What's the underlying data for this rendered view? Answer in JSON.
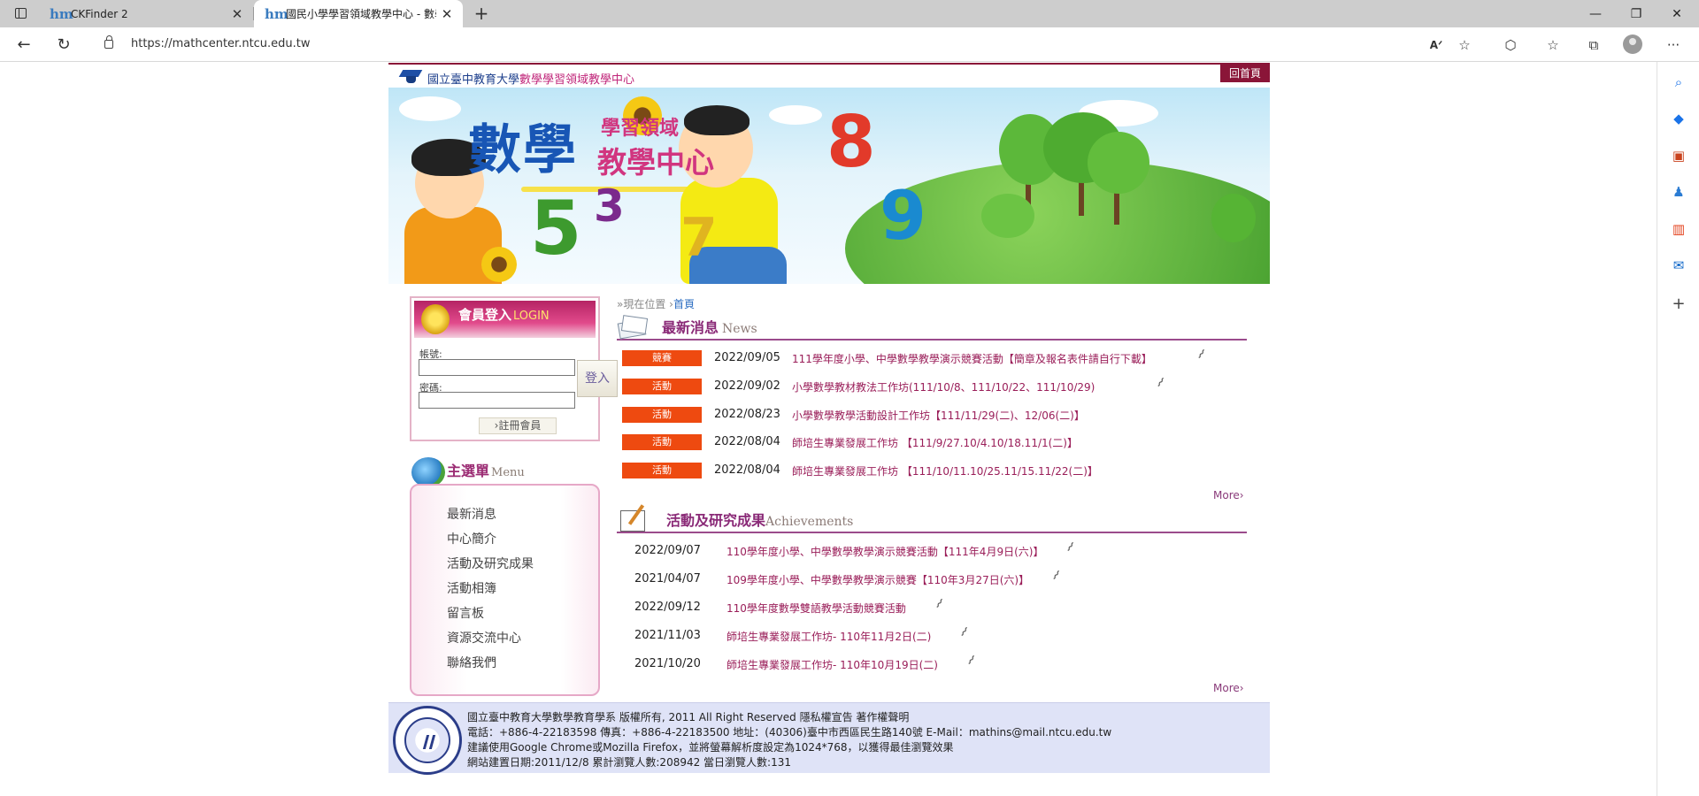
{
  "browser": {
    "tabs": [
      {
        "title": "CKFinder 2",
        "favicon": "hm"
      },
      {
        "title": "國民小學學習領域教學中心 - 數學",
        "favicon": "hm"
      }
    ],
    "url": "https://mathcenter.ntcu.edu.tw",
    "new_tab": "+",
    "icons": [
      "sidebar-toggle-icon",
      "back-icon",
      "refresh-icon",
      "lock-icon",
      "read-aloud-icon",
      "favorite-add-icon",
      "extensions-icon",
      "favorites-icon",
      "collections-icon",
      "profile-icon",
      "more-icon"
    ],
    "side_icons": [
      "search-icon",
      "shopping-icon",
      "tools-icon",
      "games-icon",
      "office-icon",
      "outlook-icon",
      "add-icon"
    ]
  },
  "site": {
    "title_main": "國立臺中教育大學",
    "title_sub": "數學學習領域教學中心",
    "home_link": "回首頁",
    "banner": {
      "title": "數學",
      "sub1": "學習領域",
      "sub2": "教學中心",
      "numbers": [
        "5",
        "3",
        "7",
        "8",
        "9"
      ]
    },
    "login": {
      "title": "會員登入",
      "title_en": "LOGIN",
      "account_label": "帳號:",
      "password_label": "密碼:",
      "submit": "登入",
      "register": "›註冊會員"
    },
    "menu": {
      "title": "主選單",
      "title_en": "Menu",
      "items": [
        "最新消息",
        "中心簡介",
        "活動及研究成果",
        "活動相簿",
        "留言板",
        "資源交流中心",
        "聯絡我們"
      ]
    },
    "breadcrumb": {
      "prefix": "»現在位置 ›",
      "current": "首頁"
    },
    "news": {
      "title": "最新消息",
      "title_en": "News",
      "more": "More›",
      "items": [
        {
          "badge": "競賽",
          "date": "2022/09/05",
          "title": "111學年度小學、中學數學教學演示競賽活動【簡章及報名表件請自行下載】"
        },
        {
          "badge": "活動",
          "date": "2022/09/02",
          "title": "小學數學教材教法工作坊(111/10/8、111/10/22、111/10/29)"
        },
        {
          "badge": "活動",
          "date": "2022/08/23",
          "title": "小學數學教學活動設計工作坊【111/11/29(二)、12/06(二)】"
        },
        {
          "badge": "活動",
          "date": "2022/08/04",
          "title": "師培生專業發展工作坊 【111/9/27.10/4.10/18.11/1(二)】"
        },
        {
          "badge": "活動",
          "date": "2022/08/04",
          "title": "師培生專業發展工作坊 【111/10/11.10/25.11/15.11/22(二)】"
        }
      ]
    },
    "achievements": {
      "title": "活動及研究成果",
      "title_en": "Achievements",
      "more": "More›",
      "items": [
        {
          "date": "2022/09/07",
          "title": "110學年度小學、中學數學教學演示競賽活動【111年4月9日(六)】"
        },
        {
          "date": "2021/04/07",
          "title": "109學年度小學、中學數學教學演示競賽【110年3月27日(六)】"
        },
        {
          "date": "2022/09/12",
          "title": "110學年度數學雙語教學活動競賽活動"
        },
        {
          "date": "2021/11/03",
          "title": "師培生專業發展工作坊- 110年11月2日(二)"
        },
        {
          "date": "2021/10/20",
          "title": "師培生專業發展工作坊- 110年10月19日(二)"
        }
      ]
    },
    "footer": {
      "line1": "國立臺中教育大學數學教育學系 版權所有, 2011 All Right Reserved 隱私權宣告 著作權聲明",
      "line2": "電話：+886-4-22183598 傳真：+886-4-22183500 地址：(40306)臺中市西區民生路140號 E-Mail：mathins@mail.ntcu.edu.tw",
      "line3": "建議使用Google Chrome或Mozilla Firefox，並將螢幕解析度設定為1024*768，以獲得最佳瀏覽效果",
      "line4": "網站建置日期:2011/12/8 累計瀏覽人數:208942 當日瀏覽人數:131"
    }
  },
  "colors": {
    "brand": "#8a1538",
    "badge": "#ee4a10",
    "link": "#9a1e59",
    "accent": "#1856b5"
  }
}
